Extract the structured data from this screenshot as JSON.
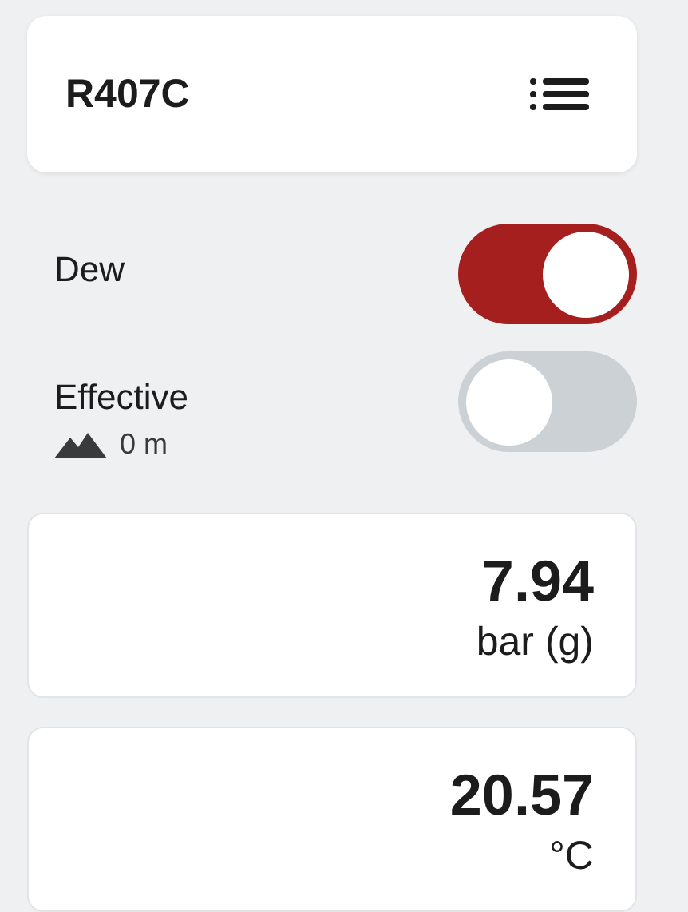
{
  "header": {
    "title": "R407C"
  },
  "toggles": [
    {
      "label": "Dew",
      "on": true
    },
    {
      "label": "Effective",
      "on": false,
      "altitude": "0 m"
    }
  ],
  "readings": [
    {
      "value": "7.94",
      "unit": "bar (g)"
    },
    {
      "value": "20.57",
      "unit": "°C"
    }
  ]
}
